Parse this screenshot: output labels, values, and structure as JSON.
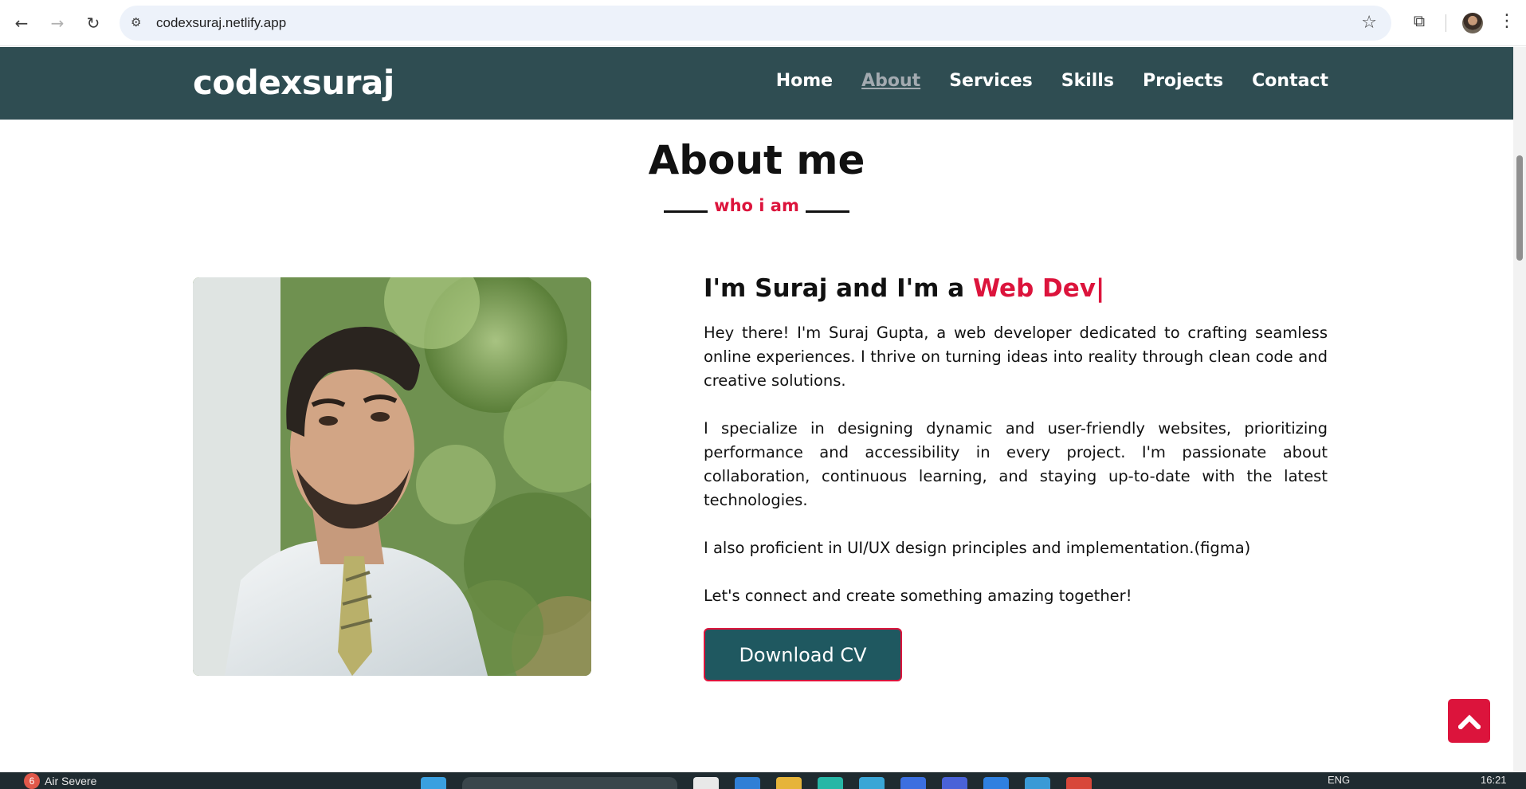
{
  "browser": {
    "url": "codexsuraj.netlify.app",
    "icons": [
      "back-icon",
      "forward-icon",
      "reload-icon",
      "site-info-icon",
      "bookmark-star-icon",
      "extensions-icon",
      "profile-avatar",
      "more-menu-icon"
    ]
  },
  "site": {
    "logo": "codexsuraj",
    "nav": [
      {
        "label": "Home",
        "active": false
      },
      {
        "label": "About",
        "active": true
      },
      {
        "label": "Services",
        "active": false
      },
      {
        "label": "Skills",
        "active": false
      },
      {
        "label": "Projects",
        "active": false
      },
      {
        "label": "Contact",
        "active": false
      }
    ],
    "colors": {
      "header_bg": "#2f4d52",
      "accent": "#dc143c",
      "button_bg": "#1f5860"
    }
  },
  "about": {
    "title": "About me",
    "subtitle": "who i am",
    "intro_prefix": "I'm Suraj and I'm a ",
    "intro_role": "Web Dev",
    "intro_caret": "|",
    "paragraphs": [
      "Hey there! I'm Suraj Gupta, a web developer dedicated to crafting seamless online experiences. I thrive on turning ideas into reality through clean code and creative solutions.",
      "I specialize in designing dynamic and user-friendly websites, prioritizing performance and accessibility in every project. I'm passionate about collaboration, continuous learning, and staying up-to-date with the latest technologies.",
      "I also proficient in UI/UX design principles and implementation.(figma)",
      "Let's connect and create something amazing together!"
    ],
    "cv_button": "Download CV"
  },
  "taskbar": {
    "weather_badge": "6",
    "weather_text": "Air Severe",
    "lang": "ENG",
    "time": "16:21"
  }
}
